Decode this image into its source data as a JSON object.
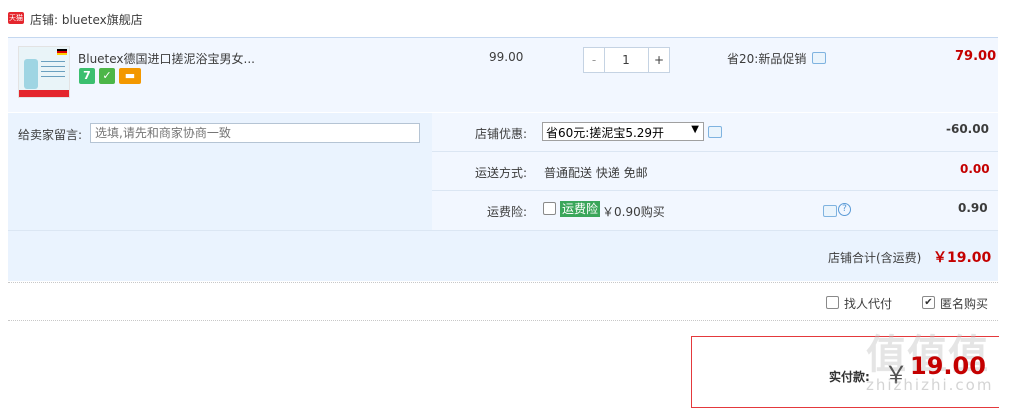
{
  "shop": {
    "badge": "天猫",
    "name": "店铺: bluetex旗舰店"
  },
  "item": {
    "title": "Bluetex德国进口搓泥浴宝男女...",
    "service_badges": [
      "7",
      "✓",
      "▬"
    ],
    "price": "99.00",
    "quantity": "1",
    "minus_label": "-",
    "plus_label": "+",
    "promo": "省20:新品促销",
    "subtotal": "79.00"
  },
  "message": {
    "label": "给卖家留言:",
    "placeholder": "选填,请先和商家协商一致"
  },
  "discount": {
    "label": "店铺优惠:",
    "selected": "省60元:搓泥宝5.29开",
    "arrow": "▼",
    "value": "-60.00"
  },
  "shipping": {
    "label": "运送方式:",
    "method": "普通配送 快递 免邮",
    "cost": "0.00"
  },
  "insurance": {
    "label": "运费险:",
    "tag": "运费险",
    "text": "￥0.90购买",
    "help": "?",
    "cost": "0.90"
  },
  "shop_total": {
    "label": "店铺合计(含运费)",
    "value": "￥19.00"
  },
  "options": {
    "proxy_pay": "找人代付",
    "anonymous": "匿名购买",
    "anonymous_checked": true
  },
  "payment": {
    "label": "实付款:",
    "currency": "￥",
    "amount": "19.00"
  },
  "watermark": {
    "logo": "值值值",
    "site": "zhizhizhi.com"
  }
}
